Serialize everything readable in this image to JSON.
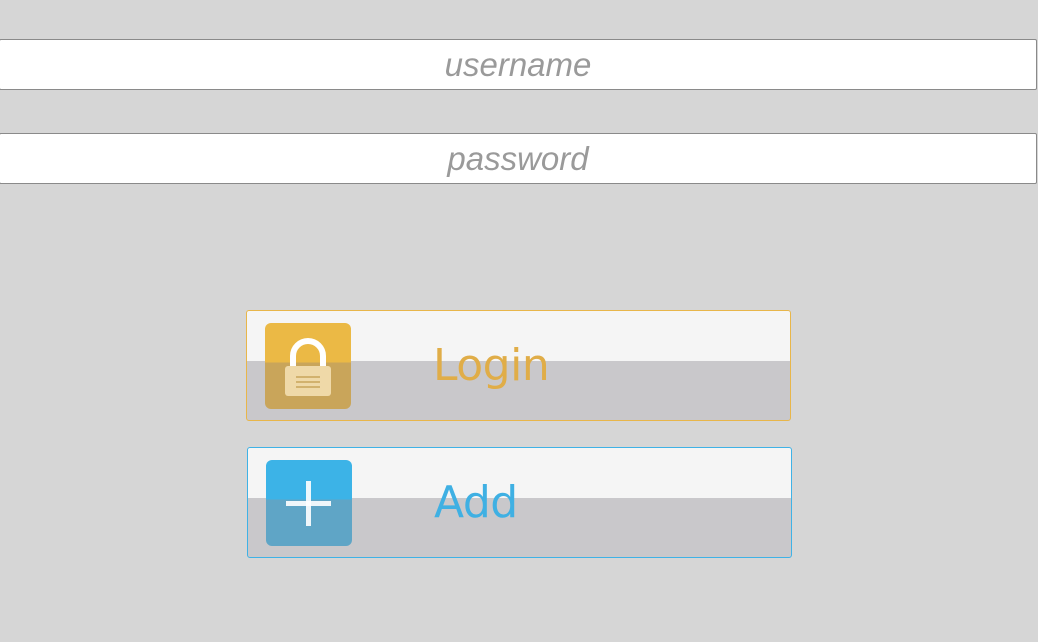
{
  "form": {
    "username": {
      "placeholder": "username",
      "value": ""
    },
    "password": {
      "placeholder": "password",
      "value": ""
    }
  },
  "buttons": {
    "login": {
      "label": "Login",
      "icon": "lock-icon",
      "accent": "#ebb945"
    },
    "add": {
      "label": "Add",
      "icon": "plus-icon",
      "accent": "#3cb3e7"
    }
  },
  "colors": {
    "background": "#d6d6d6",
    "field_background": "#ffffff",
    "placeholder": "#9a9a9a"
  }
}
